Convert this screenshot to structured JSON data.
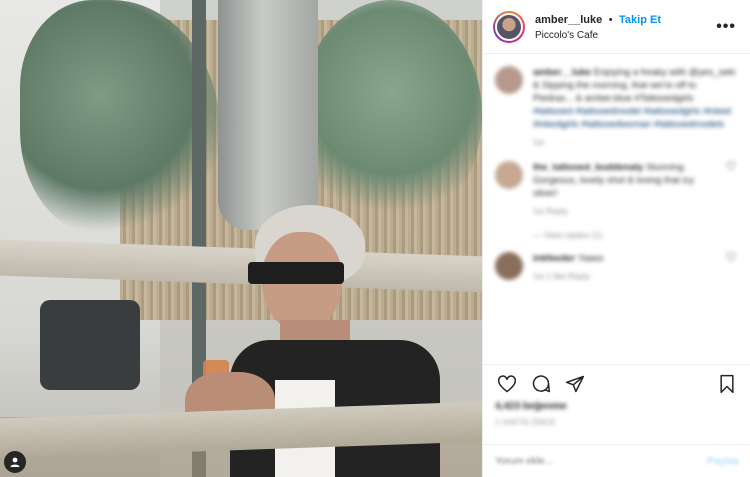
{
  "post": {
    "username": "amber__luke",
    "separator": "•",
    "follow_label": "Takip Et",
    "location": "Piccolo's Cafe",
    "more_label": "•••"
  },
  "comments": [
    {
      "user": "amber__luke",
      "text": "Enjoying a freaky with @yes_seki & Sipping the morning, that we're off to Piedras... & amber.blue #Tattooedgirls",
      "tags": "#tattooed #tattooedmodel #tattooedgirls #inked #inkedgirls #tattooedwoman #tattooedmodels",
      "meta": "1w"
    },
    {
      "user": "the_tattooed_buddenaty",
      "text": "Stunning. Gorgeous, lovely shot & loving that icy silver!",
      "meta": "1w   Reply",
      "replies": "— View replies (1)"
    },
    {
      "user": "inkfeeder",
      "text": "Yaass",
      "meta": "1w   1 like   Reply"
    }
  ],
  "actions": {
    "likes": "4,423 beğenme",
    "date": "1 HAFTA ÖNCE"
  },
  "add_comment": {
    "placeholder": "Yorum ekle...",
    "post_label": "Paylaş"
  },
  "colors": {
    "follow_blue": "#0095f6",
    "post_disabled": "#b2dffc",
    "text_primary": "#262626",
    "text_secondary": "#8e8e8e"
  },
  "icons": {
    "user_tag": "user-tag-icon",
    "like": "heart-icon",
    "comment": "comment-icon",
    "share": "share-icon",
    "save": "bookmark-icon",
    "more": "more-options-icon"
  }
}
